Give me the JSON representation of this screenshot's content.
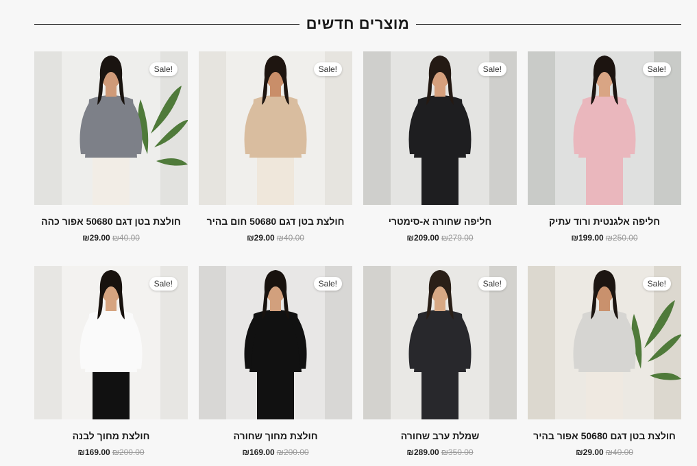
{
  "section": {
    "title": "מוצרים חדשים"
  },
  "sale_label": "Sale!",
  "products": [
    {
      "title": "חליפה אלגנטית ורוד עתיק",
      "old_price": "₪250.00",
      "new_price": "₪199.00",
      "image": "woman-pink-suit"
    },
    {
      "title": "חליפה שחורה א-סימטרי",
      "old_price": "₪279.00",
      "new_price": "₪209.00",
      "image": "woman-black-suit"
    },
    {
      "title": "חולצת בטן דגם 50680 חום בהיר",
      "old_price": "₪40.00",
      "new_price": "₪29.00",
      "image": "woman-beige-crop-top"
    },
    {
      "title": "חולצת בטן דגם 50680 אפור כהה",
      "old_price": "₪40.00",
      "new_price": "₪29.00",
      "image": "woman-grey-crop-top"
    },
    {
      "title": "חולצת בטן דגם 50680 אפור בהיר",
      "old_price": "₪40.00",
      "new_price": "₪29.00",
      "image": "woman-light-grey-crop-top"
    },
    {
      "title": "שמלת ערב שחורה",
      "old_price": "₪350.00",
      "new_price": "₪289.00",
      "image": "woman-black-dress"
    },
    {
      "title": "חולצת מחוך שחורה",
      "old_price": "₪200.00",
      "new_price": "₪169.00",
      "image": "woman-black-corset-top"
    },
    {
      "title": "חולצת מחוך לבנה",
      "old_price": "₪200.00",
      "new_price": "₪169.00",
      "image": "woman-white-corset-top"
    }
  ]
}
